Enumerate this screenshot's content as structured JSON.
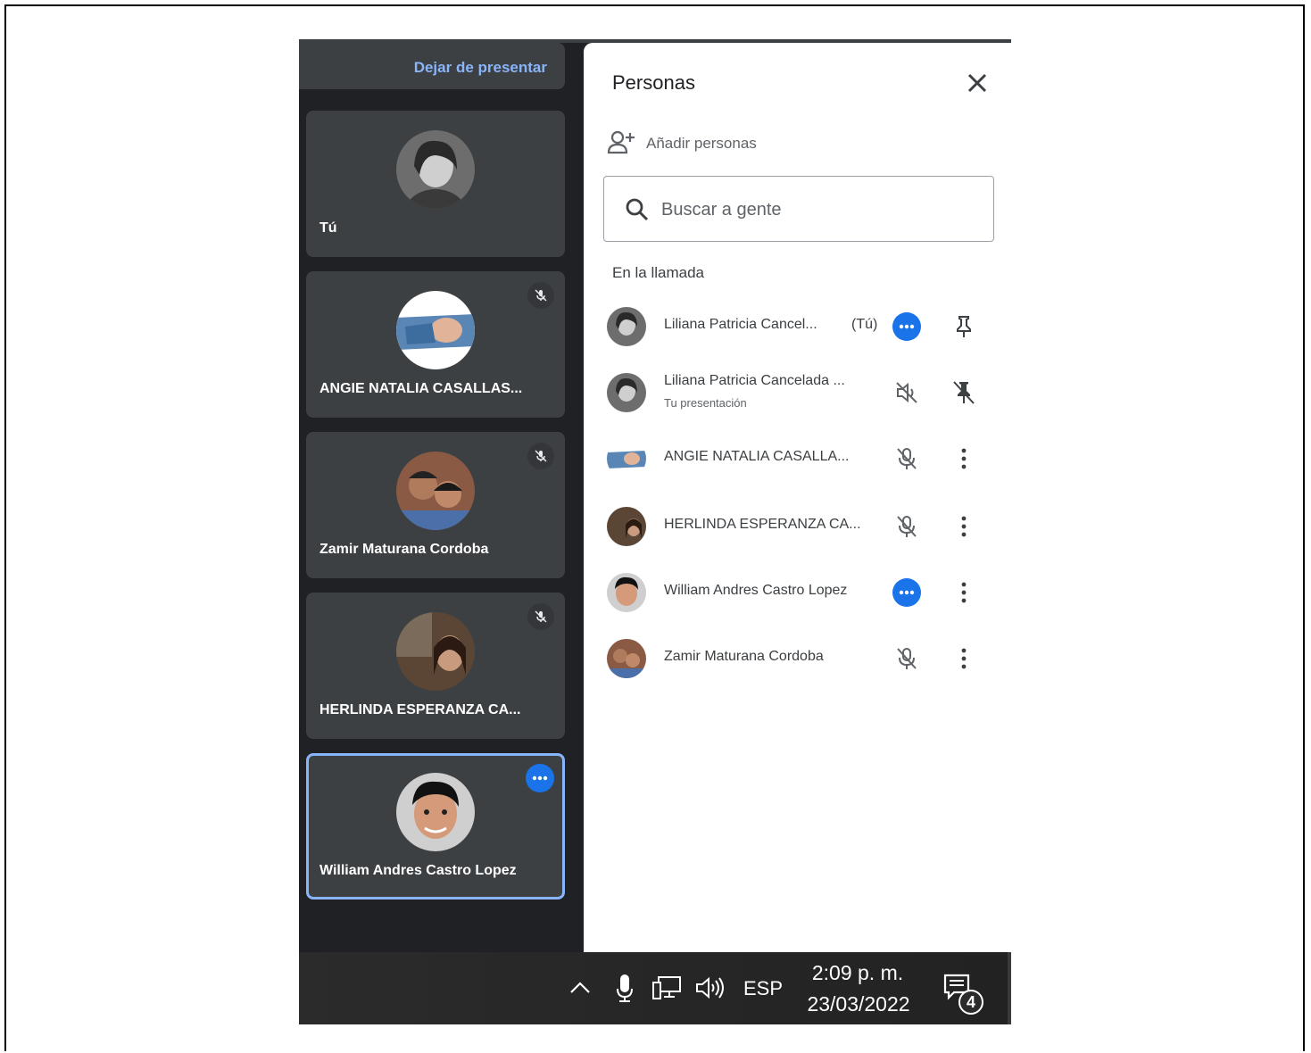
{
  "sidebar": {
    "stop_presenting": "Dejar de presentar",
    "tiles": [
      {
        "name": "Tú",
        "muted": false,
        "more": false,
        "active": false,
        "avatar": "avatar-liliana"
      },
      {
        "name": "ANGIE NATALIA CASALLAS...",
        "muted": true,
        "more": false,
        "active": false,
        "avatar": "avatar-angie"
      },
      {
        "name": "Zamir Maturana Cordoba",
        "muted": true,
        "more": false,
        "active": false,
        "avatar": "avatar-zamir"
      },
      {
        "name": "HERLINDA ESPERANZA CA...",
        "muted": true,
        "more": false,
        "active": false,
        "avatar": "avatar-herlinda"
      },
      {
        "name": "William Andres Castro Lopez",
        "muted": false,
        "more": true,
        "active": true,
        "avatar": "avatar-william"
      }
    ]
  },
  "panel": {
    "title": "Personas",
    "add_people": "Añadir personas",
    "search_placeholder": "Buscar a gente",
    "section_label": "En la llamada",
    "people": [
      {
        "name": "Liliana Patricia Cancel...",
        "you_label": "(Tú)",
        "subtitle": "",
        "icon1": "more-dot",
        "icon2": "pin-icon"
      },
      {
        "name": "Liliana Patricia Cancelada ...",
        "you_label": "",
        "subtitle": "Tu presentación",
        "icon1": "volume-off-icon",
        "icon2": "unpin-icon"
      },
      {
        "name": "ANGIE NATALIA CASALLA...",
        "you_label": "",
        "subtitle": "",
        "icon1": "mic-off-icon",
        "icon2": "kebab-menu-icon"
      },
      {
        "name": "HERLINDA ESPERANZA CA...",
        "you_label": "",
        "subtitle": "",
        "icon1": "mic-off-icon",
        "icon2": "kebab-menu-icon"
      },
      {
        "name": "William Andres Castro Lopez",
        "you_label": "",
        "subtitle": "",
        "icon1": "more-dot",
        "icon2": "kebab-menu-icon"
      },
      {
        "name": "Zamir Maturana Cordoba",
        "you_label": "",
        "subtitle": "",
        "icon1": "mic-off-icon",
        "icon2": "kebab-menu-icon"
      }
    ]
  },
  "taskbar": {
    "language": "ESP",
    "time": "2:09 p. m.",
    "date": "23/03/2022",
    "notifications": "4"
  },
  "colors": {
    "accent": "#1a73e8",
    "link": "#8ab4f8",
    "tile_bg": "#3c4043",
    "screen_bg": "#202124"
  }
}
